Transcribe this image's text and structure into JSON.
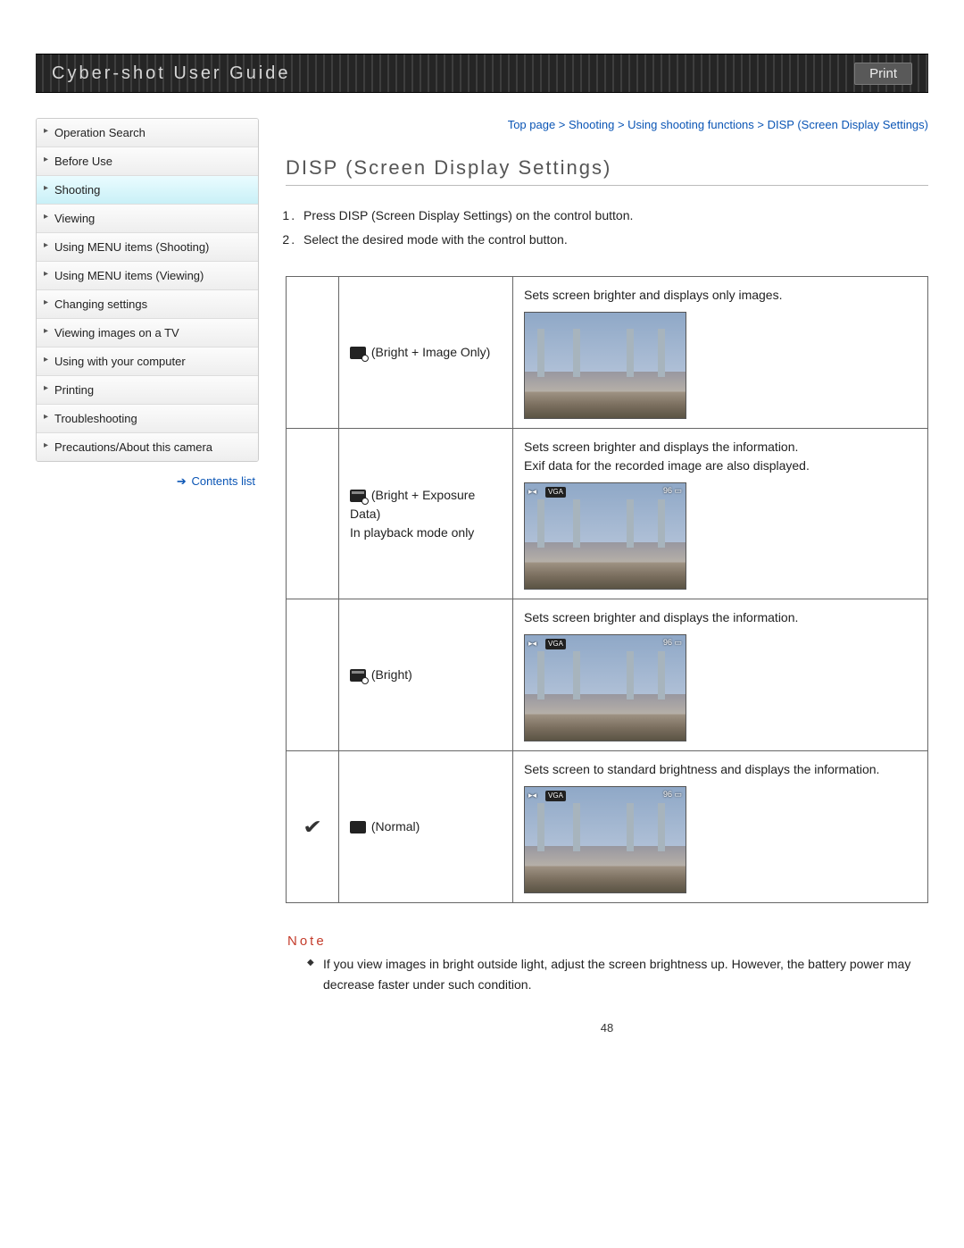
{
  "header": {
    "title": "Cyber-shot User Guide",
    "print_label": "Print"
  },
  "sidebar": {
    "items": [
      "Operation Search",
      "Before Use",
      "Shooting",
      "Viewing",
      "Using MENU items (Shooting)",
      "Using MENU items (Viewing)",
      "Changing settings",
      "Viewing images on a TV",
      "Using with your computer",
      "Printing",
      "Troubleshooting",
      "Precautions/About this camera"
    ],
    "active_index": 2,
    "contents_list": "Contents list"
  },
  "breadcrumb": "Top page > Shooting > Using shooting functions > DISP (Screen Display Settings)",
  "page_title": "DISP (Screen Display Settings)",
  "steps": [
    "Press DISP (Screen Display Settings) on the control button.",
    "Select the desired mode with the control button."
  ],
  "modes": [
    {
      "checked": false,
      "label": "(Bright + Image Only)",
      "sub": "",
      "desc": "Sets screen brighter and displays only images.",
      "osd": false
    },
    {
      "checked": false,
      "label": "(Bright + Exposure Data)",
      "sub": "In playback mode only",
      "desc": "Sets screen brighter and displays the information.\nExif data for the recorded image are also displayed.",
      "osd": true
    },
    {
      "checked": false,
      "label": "(Bright)",
      "sub": "",
      "desc": "Sets screen brighter and displays the information.",
      "osd": true
    },
    {
      "checked": true,
      "label": "(Normal)",
      "sub": "",
      "desc": "Sets screen to standard brightness and displays the information.",
      "osd": true
    }
  ],
  "osd_overlay": {
    "left_icon": "▸◂",
    "vga": "VGA",
    "count": "96",
    "lines": [
      "",
      "",
      ""
    ]
  },
  "note": {
    "title": "Note",
    "items": [
      "If you view images in bright outside light, adjust the screen brightness up. However, the battery power may decrease faster under such condition."
    ]
  },
  "page_number": "48"
}
